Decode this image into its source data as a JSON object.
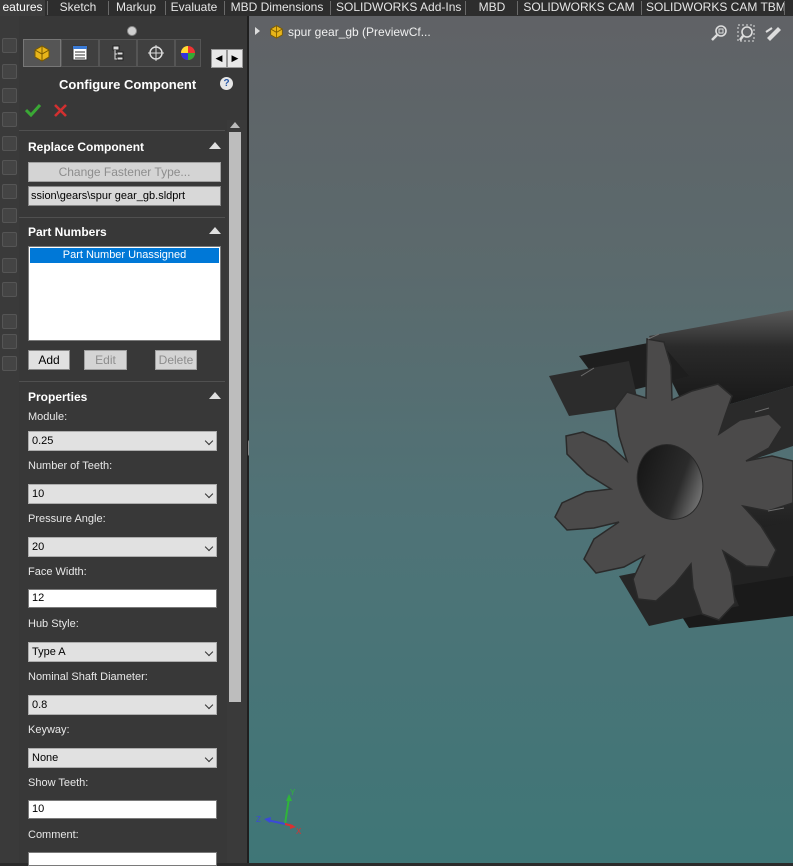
{
  "top_tabs": [
    {
      "label": "eatures",
      "active": true
    },
    {
      "label": "Sketch"
    },
    {
      "label": "Markup"
    },
    {
      "label": "Evaluate"
    },
    {
      "label": "MBD Dimensions"
    },
    {
      "label": "SOLIDWORKS Add-Ins"
    },
    {
      "label": "MBD"
    },
    {
      "label": "SOLIDWORKS CAM"
    },
    {
      "label": "SOLIDWORKS CAM TBM"
    }
  ],
  "panel": {
    "title": "Configure Component",
    "help_icon": "help-icon",
    "ok_icon": "checkmark-icon",
    "cancel_icon": "red-x-icon",
    "tab_icons": [
      "component-icon",
      "property-manager-icon",
      "configuration-manager-icon",
      "dimxpert-icon",
      "appearance-icon"
    ],
    "replace": {
      "heading": "Replace Component",
      "change_fastener_label": "Change Fastener Type...",
      "path": "ssion\\gears\\spur gear_gb.sldprt"
    },
    "part_numbers": {
      "heading": "Part Numbers",
      "items": [
        "Part Number Unassigned"
      ],
      "add_label": "Add",
      "edit_label": "Edit",
      "delete_label": "Delete"
    },
    "properties": {
      "heading": "Properties",
      "module_label": "Module:",
      "module_value": "0.25",
      "teeth_label": "Number of Teeth:",
      "teeth_value": "10",
      "pressure_label": "Pressure Angle:",
      "pressure_value": "20",
      "face_label": "Face Width:",
      "face_value": "12",
      "hub_label": "Hub Style:",
      "hub_value": "Type A",
      "shaft_label": "Nominal Shaft Diameter:",
      "shaft_value": "0.8",
      "keyway_label": "Keyway:",
      "keyway_value": "None",
      "show_teeth_label": "Show Teeth:",
      "show_teeth_value": "10",
      "comment_label": "Comment:",
      "comment_value": ""
    }
  },
  "viewport": {
    "breadcrumb": "spur gear_gb  (PreviewCf...",
    "tool_icons": [
      "zoom-to-fit-icon",
      "zoom-to-area-icon",
      "view-orientation-icon"
    ],
    "triad_labels": {
      "x": "X",
      "y": "Y",
      "z": "Z"
    }
  },
  "colors": {
    "panel_bg": "#383838",
    "selection": "#0078d7",
    "viewport_top": "#606266",
    "viewport_bottom": "#3f7677",
    "gear_face": "#4a4949"
  }
}
